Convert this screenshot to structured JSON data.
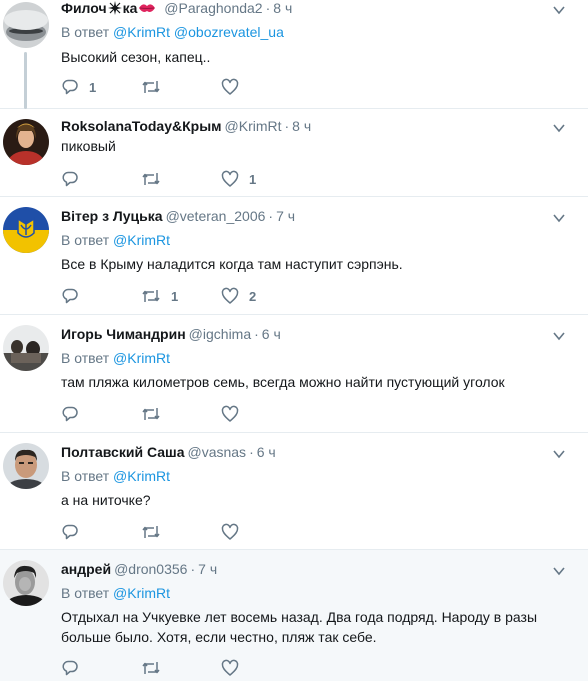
{
  "reply_prefix": "В ответ",
  "tweets": [
    {
      "name": "Филоч",
      "name_mid": "ка",
      "handle": "@Paraghonda2",
      "time": "8 ч",
      "mentions": [
        "@KrimRt",
        "@obozrevatel_ua"
      ],
      "text": "Высокий сезон, капец..",
      "replies": "1",
      "retweets": "",
      "likes": ""
    },
    {
      "name": "RoksolanaToday&Крым",
      "handle": "@KrimRt",
      "time": "8 ч",
      "text": "пиковый",
      "replies": "",
      "retweets": "",
      "likes": "1"
    },
    {
      "name": "Вітер з Луцька",
      "handle": "@veteran_2006",
      "time": "7 ч",
      "mentions": [
        "@KrimRt"
      ],
      "text": "Все в Крыму наладится когда там наступит сэрпэнь.",
      "replies": "",
      "retweets": "1",
      "likes": "2"
    },
    {
      "name": "Игорь Чимандрин",
      "handle": "@igchima",
      "time": "6 ч",
      "mentions": [
        "@KrimRt"
      ],
      "text": "там пляжа километров семь, всегда можно найти пустующий уголок",
      "replies": "",
      "retweets": "",
      "likes": ""
    },
    {
      "name": "Полтавский Саша",
      "handle": "@vasnas",
      "time": "6 ч",
      "mentions": [
        "@KrimRt"
      ],
      "text": "а на ниточке?",
      "replies": "",
      "retweets": "",
      "likes": ""
    },
    {
      "name": "андрей",
      "handle": "@dron0356",
      "time": "7 ч",
      "mentions": [
        "@KrimRt"
      ],
      "text": "Отдыхал на Учкуевке лет восемь назад. Два года подряд. Народу в разы больше было. Хотя, если честно, пляж так себе.",
      "replies": "",
      "retweets": "",
      "likes": ""
    }
  ],
  "colors": {
    "text": "#14171a",
    "muted": "#657786",
    "link": "#1b95e0",
    "border": "#e6ecf0",
    "highlight_bg": "#f5f8fa",
    "thread_line": "#c4cfd6"
  },
  "icons": [
    "reply-icon",
    "retweet-icon",
    "like-icon",
    "caret-down-icon",
    "sparkle-icon",
    "kiss-icon"
  ]
}
